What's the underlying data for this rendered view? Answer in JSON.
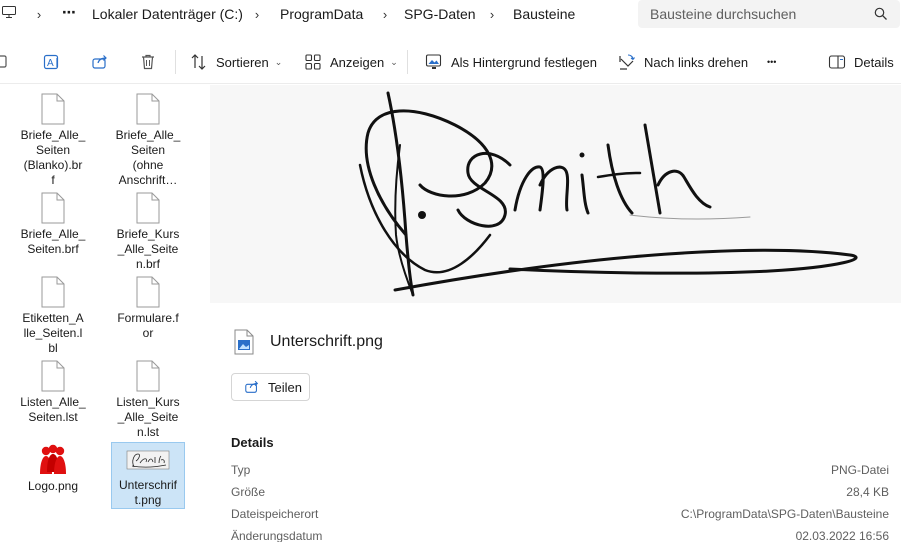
{
  "breadcrumb": {
    "more": "⋯",
    "items": [
      "Lokaler Datenträger (C:)",
      "ProgramData",
      "SPG-Daten",
      "Bausteine"
    ]
  },
  "search": {
    "placeholder": "Bausteine durchsuchen",
    "icon": "search-icon"
  },
  "toolbar": {
    "sort_label": "Sortieren",
    "view_label": "Anzeigen",
    "wallpaper_label": "Als Hintergrund festlegen",
    "rotate_label": "Nach links drehen",
    "more_label": "•••",
    "details_label": "Details"
  },
  "files": [
    {
      "name": "Briefe_Alle_\nSeiten\n(Blanko).br\nf",
      "icon": "document-icon"
    },
    {
      "name": "Briefe_Alle_\nSeiten\n(ohne\nAnschrift…",
      "icon": "document-icon"
    },
    {
      "name": "Briefe_Alle_\nSeiten.brf",
      "icon": "document-icon"
    },
    {
      "name": "Briefe_Kurs\n_Alle_Seite\nn.brf",
      "icon": "document-icon"
    },
    {
      "name": "Etiketten_A\nlle_Seiten.l\nbl",
      "icon": "document-icon"
    },
    {
      "name": "Formulare.f\nor",
      "icon": "document-icon"
    },
    {
      "name": "Listen_Alle_\nSeiten.lst",
      "icon": "document-icon"
    },
    {
      "name": "Listen_Kurs\n_Alle_Seite\nn.lst",
      "icon": "document-icon"
    },
    {
      "name": "Logo.png",
      "icon": "logo-image-icon"
    },
    {
      "name": "Unterschrif\nt.png",
      "icon": "signature-thumbnail-icon",
      "selected": true
    }
  ],
  "preview": {
    "file_name": "Unterschrift.png",
    "share_label": "Teilen",
    "details_heading": "Details",
    "details": [
      {
        "key": "Typ",
        "value": "PNG-Datei"
      },
      {
        "key": "Größe",
        "value": "28,4 KB"
      },
      {
        "key": "Dateispeicherort",
        "value": "C:\\ProgramData\\SPG-Daten\\Bausteine"
      },
      {
        "key": "Änderungsdatum",
        "value": "02.03.2022 16:56"
      }
    ]
  },
  "colors": {
    "selection": "#cce4f7",
    "accent": "#0067c0",
    "logo": "#e01010"
  }
}
